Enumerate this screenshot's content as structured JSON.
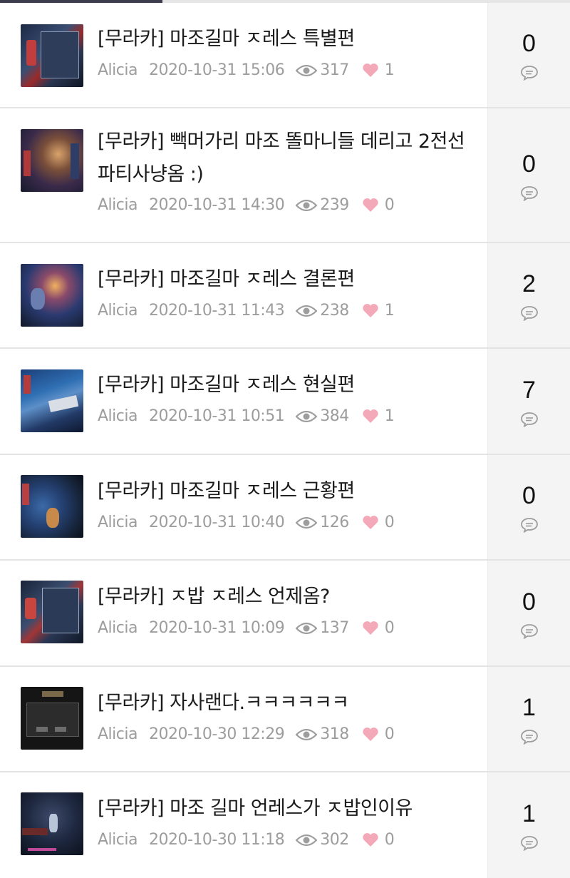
{
  "colors": {
    "accent_tab": "#3b3d4f",
    "heart": "#f4a9b8",
    "meta_text": "#9d9d9d"
  },
  "posts": [
    {
      "title": "[무라카] 마조길마 ㅈ레스 특별편",
      "author": "Alicia",
      "date": "2020-10-31 15:06",
      "views": "317",
      "likes": "1",
      "comments": "0"
    },
    {
      "title": "[무라카] 빽머가리 마조 똘마니들 데리고 2전선 파티사냥옴 :)",
      "author": "Alicia",
      "date": "2020-10-31 14:30",
      "views": "239",
      "likes": "0",
      "comments": "0"
    },
    {
      "title": "[무라카] 마조길마 ㅈ레스 결론편",
      "author": "Alicia",
      "date": "2020-10-31 11:43",
      "views": "238",
      "likes": "1",
      "comments": "2"
    },
    {
      "title": "[무라카] 마조길마 ㅈ레스 현실편",
      "author": "Alicia",
      "date": "2020-10-31 10:51",
      "views": "384",
      "likes": "1",
      "comments": "7"
    },
    {
      "title": "[무라카] 마조길마 ㅈ레스 근황편",
      "author": "Alicia",
      "date": "2020-10-31 10:40",
      "views": "126",
      "likes": "0",
      "comments": "0"
    },
    {
      "title": "[무라카] ㅈ밥 ㅈ레스 언제옴?",
      "author": "Alicia",
      "date": "2020-10-31 10:09",
      "views": "137",
      "likes": "0",
      "comments": "0"
    },
    {
      "title": "[무라카] 자사랜다.ㅋㅋㅋㅋㅋㅋ",
      "author": "Alicia",
      "date": "2020-10-30 12:29",
      "views": "318",
      "likes": "0",
      "comments": "1"
    },
    {
      "title": "[무라카] 마조 길마 언레스가 ㅈ밥인이유",
      "author": "Alicia",
      "date": "2020-10-30 11:18",
      "views": "302",
      "likes": "0",
      "comments": "1"
    }
  ]
}
